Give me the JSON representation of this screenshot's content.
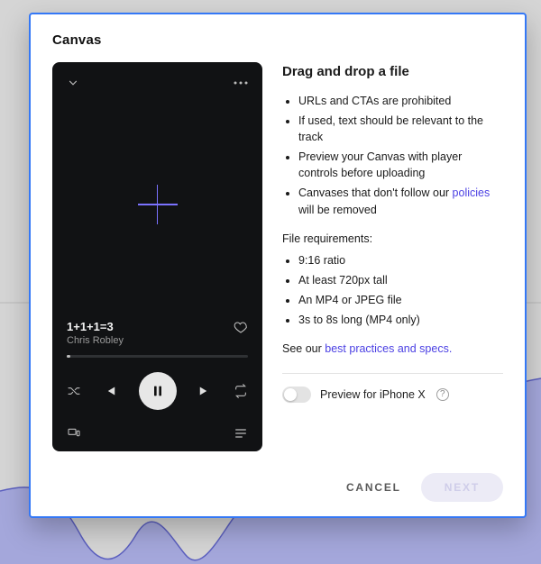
{
  "modal": {
    "title": "Canvas"
  },
  "player": {
    "track_title": "1+1+1=3",
    "artist": "Chris Robley"
  },
  "instructions": {
    "heading": "Drag and drop a file",
    "rules": [
      "URLs and CTAs are prohibited",
      "If used, text should be relevant to the track",
      "Preview your Canvas with player controls before uploading"
    ],
    "rule_policies_prefix": "Canvases that don't follow our ",
    "rule_policies_link": "policies",
    "rule_policies_suffix": " will be removed",
    "file_req_heading": "File requirements:",
    "file_reqs": [
      "9:16 ratio",
      "At least 720px tall",
      "An MP4 or JPEG file",
      "3s to 8s long (MP4 only)"
    ],
    "see_prefix": "See our ",
    "see_link": "best practices and specs.",
    "toggle_label": "Preview for iPhone X"
  },
  "footer": {
    "cancel": "CANCEL",
    "next": "NEXT"
  }
}
